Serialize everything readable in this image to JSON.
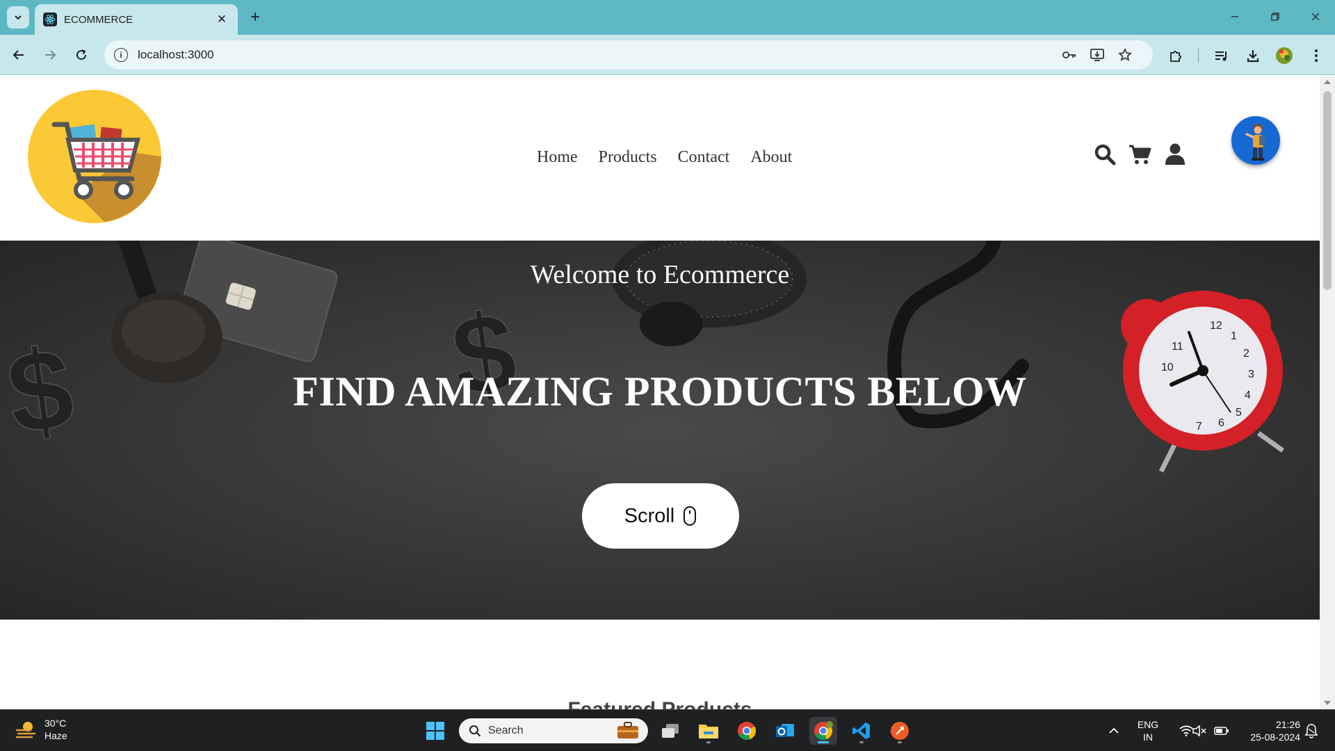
{
  "browser": {
    "tab_title": "ECOMMERCE",
    "url": "localhost:3000"
  },
  "site": {
    "nav": [
      "Home",
      "Products",
      "Contact",
      "About"
    ],
    "banner_welcome": "Welcome to Ecommerce",
    "banner_headline": "FIND AMAZING PRODUCTS BELOW",
    "scroll_button": "Scroll",
    "featured_heading": "Featured Products"
  },
  "taskbar": {
    "weather_temp": "30°C",
    "weather_desc": "Haze",
    "search_label": "Search",
    "lang_line1": "ENG",
    "lang_line2": "IN",
    "time": "21:26",
    "date": "25-08-2024"
  },
  "colors": {
    "tab_strip": "#5db8c4",
    "toolbar": "#c7e7ec",
    "banner": "#3a3a3a",
    "logo_yellow": "#fbc935",
    "avatar_blue": "#1669d3"
  }
}
